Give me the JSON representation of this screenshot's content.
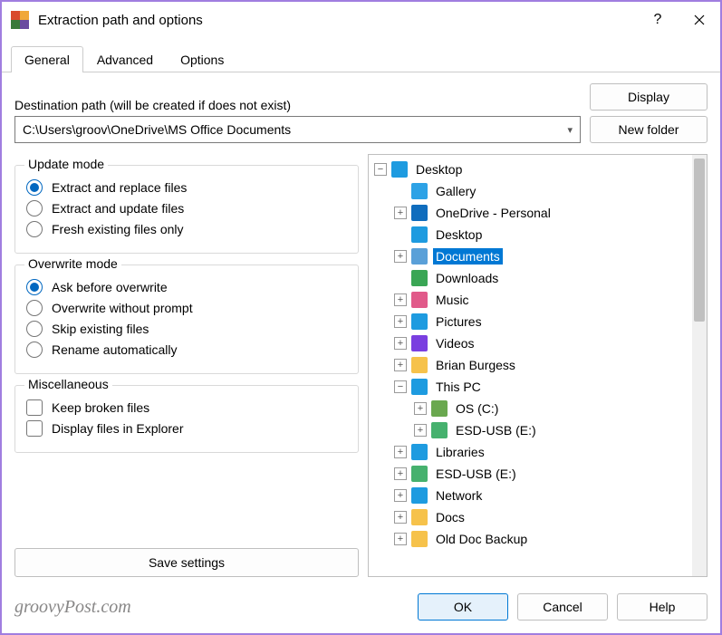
{
  "window": {
    "title": "Extraction path and options"
  },
  "tabs": [
    "General",
    "Advanced",
    "Options"
  ],
  "active_tab": 0,
  "dest_label": "Destination path (will be created if does not exist)",
  "path_value": "C:\\Users\\groov\\OneDrive\\MS Office Documents",
  "side_buttons": {
    "display": "Display",
    "new_folder": "New folder"
  },
  "groups": {
    "update": {
      "legend": "Update mode",
      "options": [
        {
          "label": "Extract and replace files",
          "checked": true
        },
        {
          "label": "Extract and update files",
          "checked": false
        },
        {
          "label": "Fresh existing files only",
          "checked": false
        }
      ]
    },
    "overwrite": {
      "legend": "Overwrite mode",
      "options": [
        {
          "label": "Ask before overwrite",
          "checked": true
        },
        {
          "label": "Overwrite without prompt",
          "checked": false
        },
        {
          "label": "Skip existing files",
          "checked": false
        },
        {
          "label": "Rename automatically",
          "checked": false
        }
      ]
    },
    "misc": {
      "legend": "Miscellaneous",
      "options": [
        {
          "label": "Keep broken files",
          "checked": false
        },
        {
          "label": "Display files in Explorer",
          "checked": false
        }
      ]
    }
  },
  "save_settings": "Save settings",
  "tree": [
    {
      "depth": 0,
      "expander": "minus",
      "icon": "desktop",
      "label": "Desktop",
      "selected": false
    },
    {
      "depth": 1,
      "expander": "blank",
      "icon": "gallery",
      "label": "Gallery",
      "selected": false
    },
    {
      "depth": 1,
      "expander": "plus",
      "icon": "onedrive",
      "label": "OneDrive - Personal",
      "selected": false
    },
    {
      "depth": 1,
      "expander": "blank",
      "icon": "desktop",
      "label": "Desktop",
      "selected": false
    },
    {
      "depth": 1,
      "expander": "plus",
      "icon": "documents",
      "label": "Documents",
      "selected": true
    },
    {
      "depth": 1,
      "expander": "blank",
      "icon": "downloads",
      "label": "Downloads",
      "selected": false
    },
    {
      "depth": 1,
      "expander": "plus",
      "icon": "music",
      "label": "Music",
      "selected": false
    },
    {
      "depth": 1,
      "expander": "plus",
      "icon": "pictures",
      "label": "Pictures",
      "selected": false
    },
    {
      "depth": 1,
      "expander": "plus",
      "icon": "videos",
      "label": "Videos",
      "selected": false
    },
    {
      "depth": 1,
      "expander": "plus",
      "icon": "folder",
      "label": "Brian Burgess",
      "selected": false
    },
    {
      "depth": 1,
      "expander": "minus",
      "icon": "thispc",
      "label": "This PC",
      "selected": false
    },
    {
      "depth": 2,
      "expander": "plus",
      "icon": "drive",
      "label": "OS (C:)",
      "selected": false
    },
    {
      "depth": 2,
      "expander": "plus",
      "icon": "usb",
      "label": "ESD-USB (E:)",
      "selected": false
    },
    {
      "depth": 1,
      "expander": "plus",
      "icon": "libraries",
      "label": "Libraries",
      "selected": false
    },
    {
      "depth": 1,
      "expander": "plus",
      "icon": "usb",
      "label": "ESD-USB (E:)",
      "selected": false
    },
    {
      "depth": 1,
      "expander": "plus",
      "icon": "network",
      "label": "Network",
      "selected": false
    },
    {
      "depth": 1,
      "expander": "plus",
      "icon": "folder",
      "label": "Docs",
      "selected": false
    },
    {
      "depth": 1,
      "expander": "plus",
      "icon": "folder",
      "label": "Old Doc Backup",
      "selected": false
    }
  ],
  "footer": {
    "ok": "OK",
    "cancel": "Cancel",
    "help": "Help"
  },
  "watermark": "groovyPost.com",
  "icon_colors": {
    "desktop": "#1e9be0",
    "gallery": "#2da2e6",
    "onedrive": "#0f6cbd",
    "documents": "#5aa0d8",
    "downloads": "#3aa655",
    "music": "#e15a8a",
    "pictures": "#1e9be0",
    "videos": "#7a3fe0",
    "folder": "#f6c24b",
    "thispc": "#1e9be0",
    "drive": "#6aa84f",
    "usb": "#46b16e",
    "libraries": "#1e9be0",
    "network": "#1e9be0"
  }
}
